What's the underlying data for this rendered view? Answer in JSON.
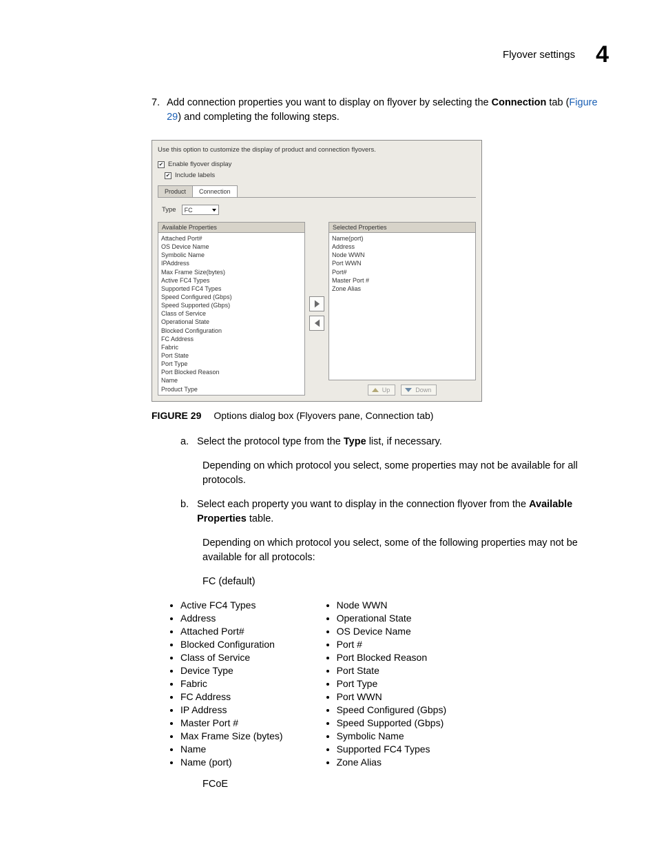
{
  "header": {
    "title": "Flyover settings",
    "chapter": "4"
  },
  "step7": {
    "num": "7.",
    "text_pre": "Add connection properties you want to display on flyover by selecting the ",
    "bold1": "Connection",
    "text_mid": " tab (",
    "link": "Figure 29",
    "text_post": ") and completing the following steps."
  },
  "dialog": {
    "intro": "Use this option to customize the display of product and connection flyovers.",
    "enable": "Enable flyover display",
    "include": "Include labels",
    "tab_product": "Product",
    "tab_connection": "Connection",
    "type_label": "Type",
    "type_value": "FC",
    "available_header": "Available Properties",
    "selected_header": "Selected Properties",
    "available": [
      "Attached Port#",
      "OS Device Name",
      "Symbolic Name",
      "IPAddress",
      "Max Frame Size(bytes)",
      "Active FC4 Types",
      "Supported FC4 Types",
      "Speed Configured (Gbps)",
      "Speed Supported (Gbps)",
      "Class of Service",
      "Operational State",
      "Blocked Configuration",
      "FC Address",
      "Fabric",
      "Port State",
      "Port Type",
      "Port Blocked Reason",
      "Name",
      "Product Type"
    ],
    "selected": [
      "Name(port)",
      "Address",
      "Node WWN",
      "Port WWN",
      "Port#",
      "Master Port #",
      "Zone Alias"
    ],
    "up": "Up",
    "down": "Down"
  },
  "figcap": {
    "num": "FIGURE 29",
    "text": "Options dialog box (Flyovers pane, Connection tab)"
  },
  "step_a": {
    "letter": "a.",
    "pre": "Select the ",
    "mid1": "protocol",
    "mid2": " type from the ",
    "bold": "Type",
    "post": " list, if necessary."
  },
  "step_a_para": "Depending on which protocol you select, some properties may not be available for all protocols.",
  "step_b": {
    "letter": "b.",
    "pre": "Select each property you want to display in the connection flyover from the ",
    "bold": "Available Properties",
    "post": " table."
  },
  "step_b_para": "Depending on which protocol you select, some of the following properties may not be available for all protocols:",
  "fc_default": "FC (default)",
  "bullets_left": [
    "Active FC4 Types",
    "Address",
    "Attached Port#",
    "Blocked Configuration",
    "Class of Service",
    "Device Type",
    "Fabric",
    "FC Address",
    "IP Address",
    "Master Port #",
    "Max Frame Size (bytes)",
    "Name",
    "Name (port)"
  ],
  "bullets_right": [
    "Node WWN",
    "Operational State",
    "OS Device Name",
    "Port #",
    "Port Blocked Reason",
    "Port State",
    "Port Type",
    "Port WWN",
    "Speed Configured (Gbps)",
    "Speed Supported (Gbps)",
    "Symbolic Name",
    "Supported FC4 Types",
    "Zone Alias"
  ],
  "fcoe": "FCoE"
}
